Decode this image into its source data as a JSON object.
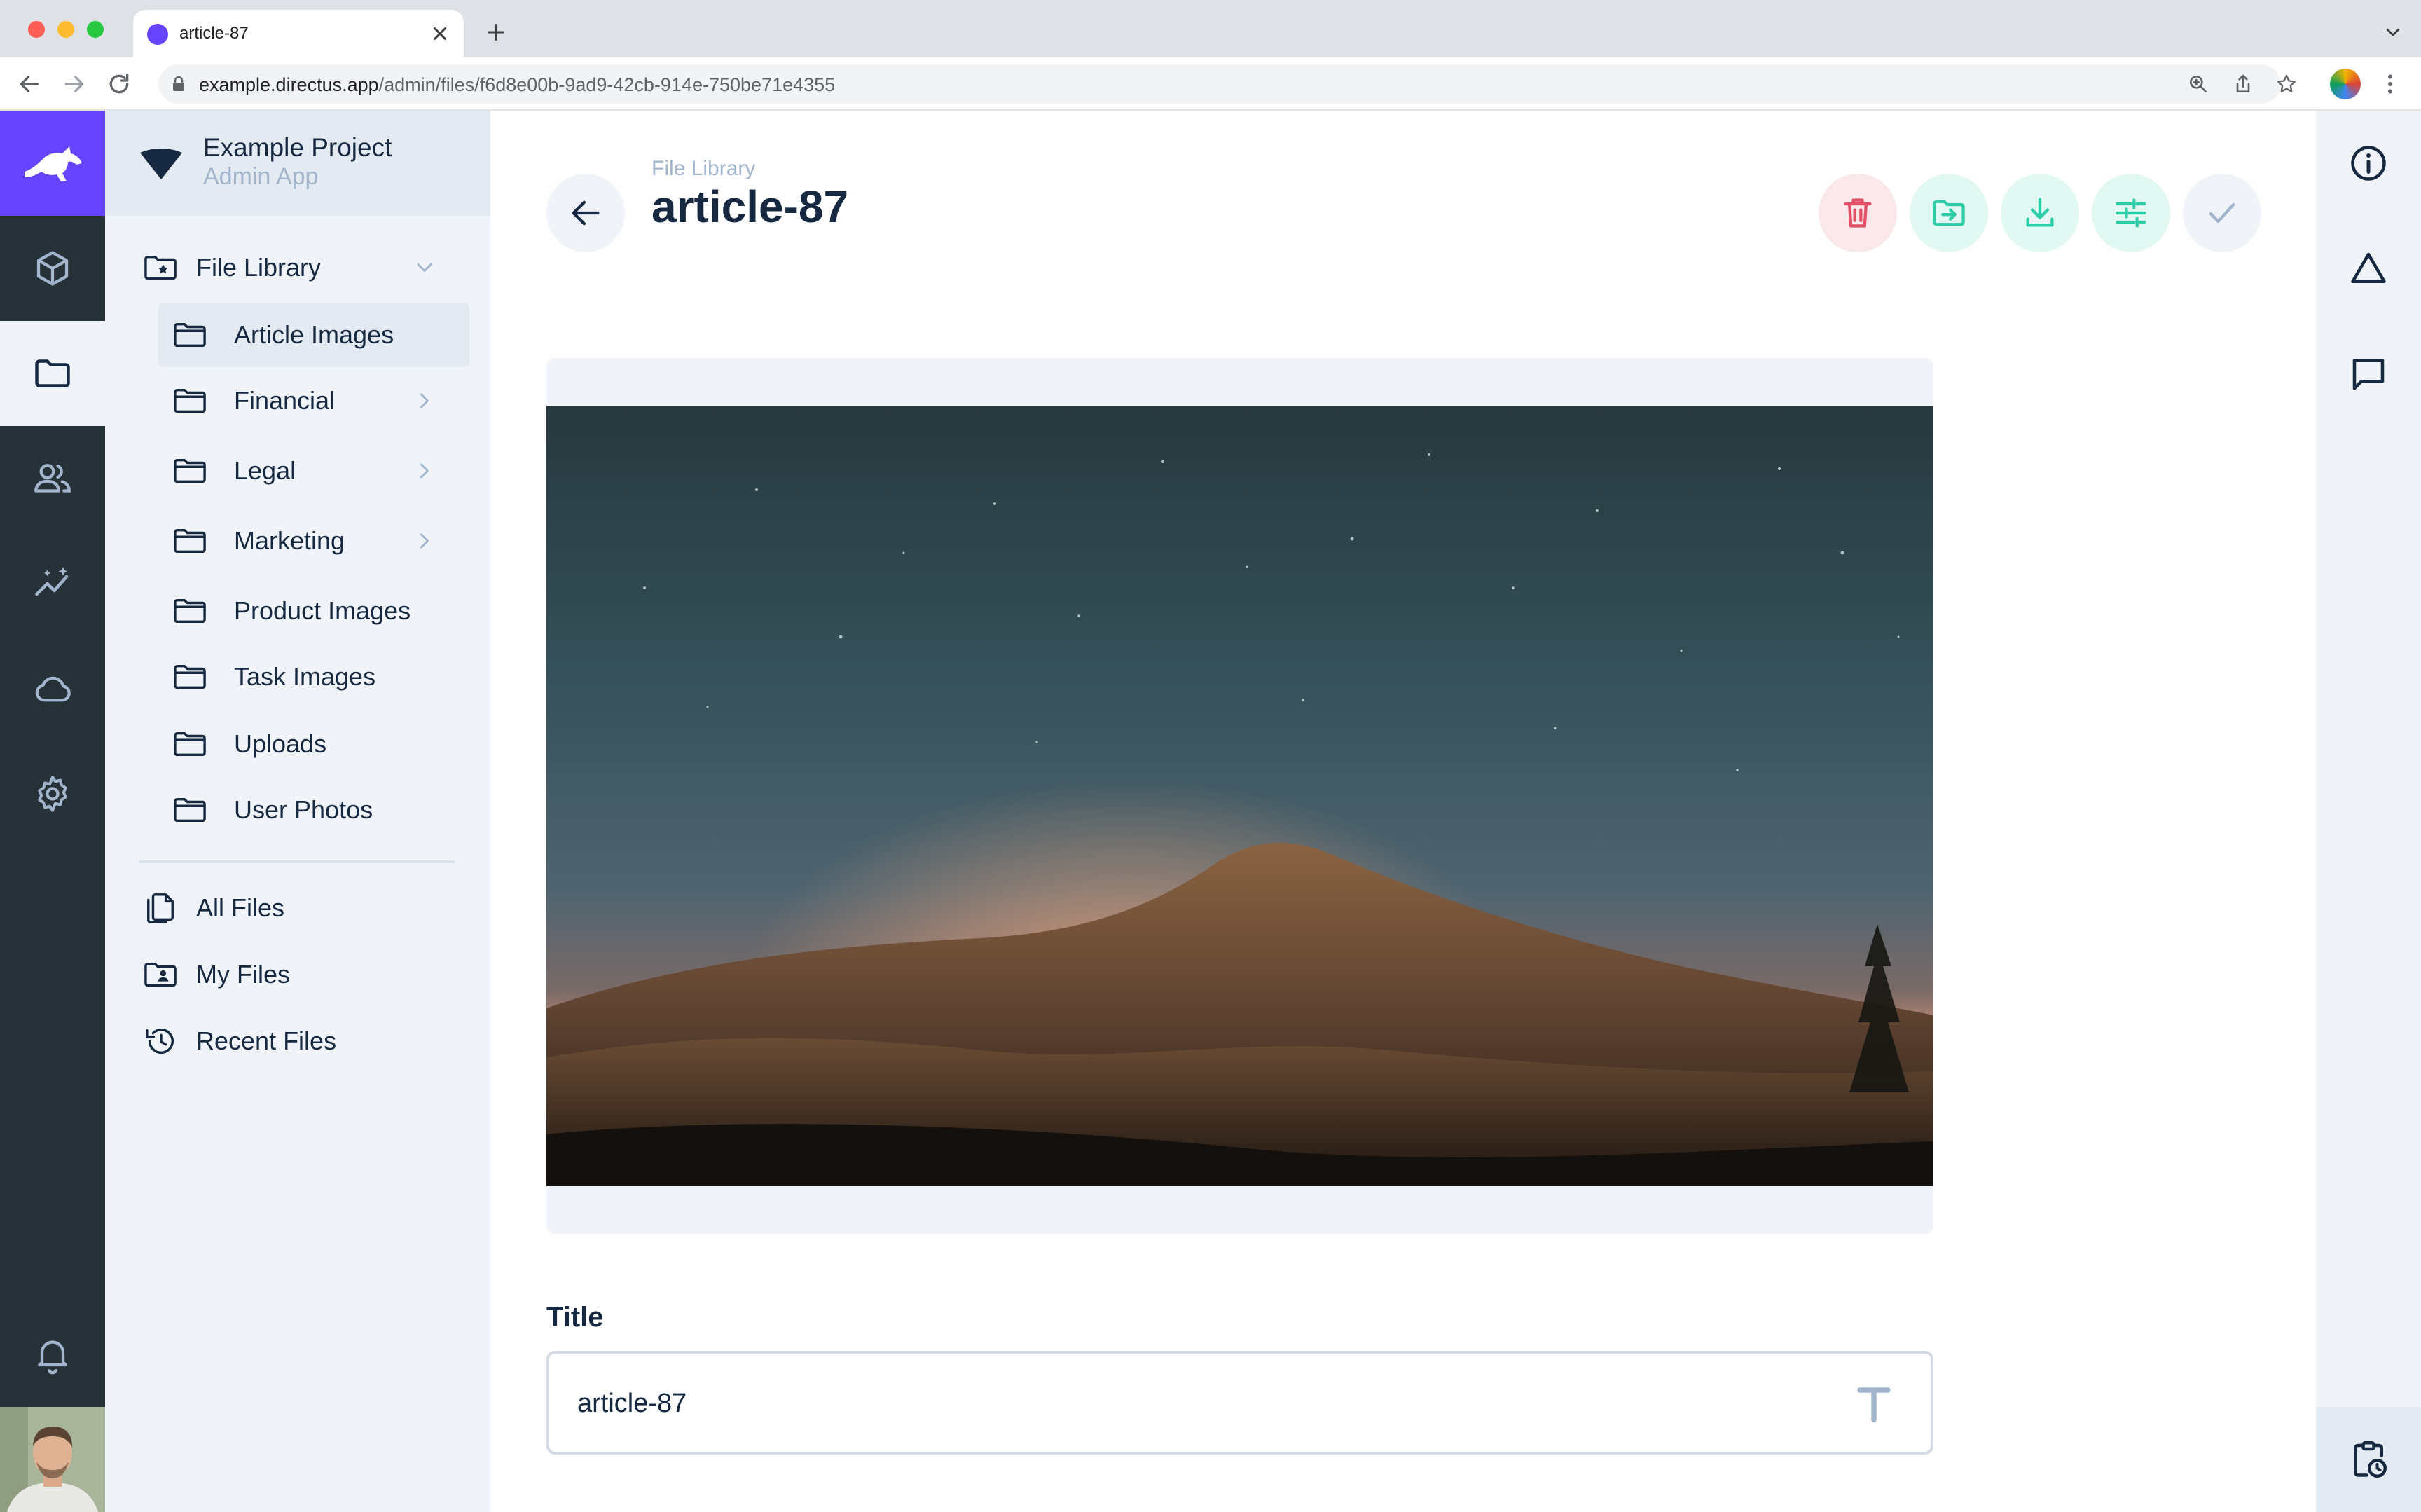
{
  "browser": {
    "tab_title": "article-87",
    "url_host": "example.directus.app",
    "url_path": "/admin/files/f6d8e00b-9ad9-42cb-914e-750be71e4355"
  },
  "project": {
    "name": "Example Project",
    "subtitle": "Admin App",
    "brand_color": "#6644FF"
  },
  "modules": [
    {
      "icon": "box-icon",
      "label": "Content"
    },
    {
      "icon": "folder-icon",
      "label": "File Library",
      "active": true
    },
    {
      "icon": "users-icon",
      "label": "User Directory"
    },
    {
      "icon": "insights-icon",
      "label": "Insights"
    },
    {
      "icon": "cloud-icon",
      "label": "Cloud"
    },
    {
      "icon": "gear-icon",
      "label": "Settings"
    }
  ],
  "nav": {
    "root": {
      "label": "File Library",
      "icon": "folder-special-icon",
      "expanded": true
    },
    "folders": [
      {
        "label": "Article Images",
        "active": true,
        "has_children": false
      },
      {
        "label": "Financial",
        "has_children": true
      },
      {
        "label": "Legal",
        "has_children": true
      },
      {
        "label": "Marketing",
        "has_children": true
      },
      {
        "label": "Product Images",
        "has_children": false
      },
      {
        "label": "Task Images",
        "has_children": false
      },
      {
        "label": "Uploads",
        "has_children": false
      },
      {
        "label": "User Photos",
        "has_children": false
      }
    ],
    "presets": [
      {
        "label": "All Files",
        "icon": "file-copy-icon"
      },
      {
        "label": "My Files",
        "icon": "folder-user-icon"
      },
      {
        "label": "Recent Files",
        "icon": "history-icon"
      }
    ]
  },
  "header": {
    "breadcrumb": "File Library",
    "title": "article-87",
    "actions": [
      {
        "name": "delete",
        "icon": "trash-icon",
        "color": "#E35169",
        "bg": "#FBE8EB"
      },
      {
        "name": "move",
        "icon": "folder-move-icon",
        "color": "#2ECDA7",
        "bg": "#E2F8F2"
      },
      {
        "name": "download",
        "icon": "download-icon",
        "color": "#2ECDA7",
        "bg": "#E2F8F2"
      },
      {
        "name": "edit",
        "icon": "tune-icon",
        "color": "#2ECDA7",
        "bg": "#E2F8F2"
      },
      {
        "name": "save",
        "icon": "check-icon",
        "color": "#A2B5CD",
        "bg": "#F0F4F9"
      }
    ]
  },
  "form": {
    "title_label": "Title",
    "title_value": "article-87"
  },
  "sidebar": {
    "items": [
      {
        "icon": "info-icon",
        "label": "File Info"
      },
      {
        "icon": "revisions-icon",
        "label": "Revisions"
      },
      {
        "icon": "comments-icon",
        "label": "Comments"
      }
    ],
    "bottom_icon": "clipboard-clock-icon"
  }
}
